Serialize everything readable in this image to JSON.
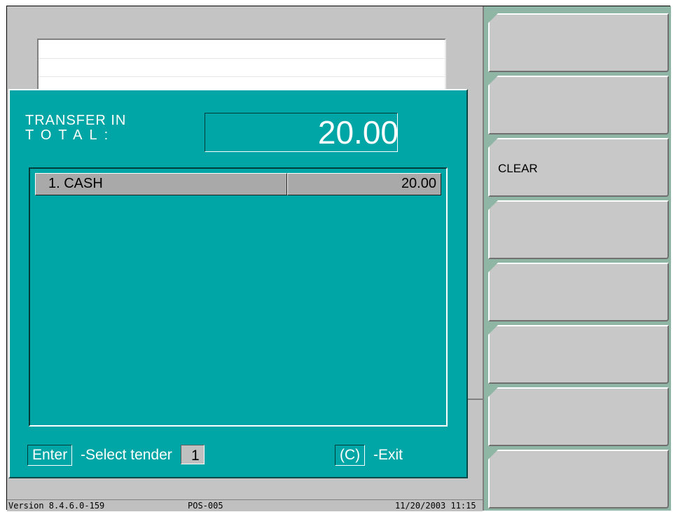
{
  "dialog": {
    "title_line1": "TRANSFER IN",
    "title_line2": "TOTAL:",
    "total_value": "20.00",
    "rows": [
      {
        "name": "1.  CASH",
        "amount": "20.00"
      }
    ],
    "footer": {
      "enter_key": "Enter",
      "enter_text": "-Select  tender",
      "tender_value": "1",
      "exit_key": "(C)",
      "exit_text": "-Exit"
    }
  },
  "status_bar": {
    "version": "Version  8.4.6.0-159",
    "terminal": "POS-005",
    "datetime": "11/20/2003 11:15"
  },
  "function_keys": [
    "",
    "",
    "CLEAR",
    "",
    "",
    "",
    "",
    ""
  ],
  "colors": {
    "dialog_bg": "#00a5a5",
    "side_bg": "#8fb5a5",
    "button_bg": "#c8c8c8"
  }
}
